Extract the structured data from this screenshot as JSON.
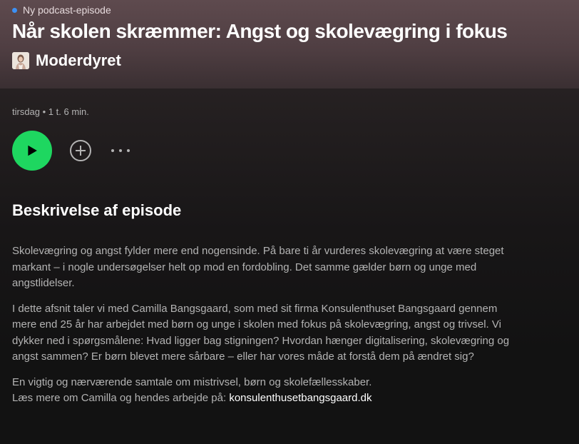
{
  "episode": {
    "badge": "Ny podcast-episode",
    "title": "Når skolen skræmmer: Angst og skolevægring i fokus",
    "show_name": "Moderdyret",
    "meta": "tirsdag • 1 t. 6 min."
  },
  "actions": {
    "play_icon": "play-icon",
    "add_icon": "add-circle-icon",
    "more_icon": "more-options-icon"
  },
  "description": {
    "heading": "Beskrivelse af episode",
    "paragraph_1": "Skolevægring og angst fylder mere end nogensinde. På bare ti år vurderes skolevægring at være steget markant – i nogle undersøgelser helt op mod en fordobling. Det samme gælder børn og unge med angstlidelser.",
    "paragraph_2": "I dette afsnit taler vi med Camilla Bangsgaard, som med sit firma Konsulenthuset Bangsgaard gennem mere end 25 år har arbejdet med børn og unge i skolen med fokus på skolevægring, angst og trivsel. Vi dykker ned i spørgsmålene: Hvad ligger bag stigningen? Hvordan hænger digitalisering, skolevægring og angst sammen? Er børn blevet mere sårbare – eller har vores måde at forstå dem på ændret sig?",
    "paragraph_3_line_1": "En vigtig og nærværende samtale om mistrivsel, børn og skolefællesskaber.",
    "paragraph_3_line_2": "Læs mere om Camilla og hendes arbejde på: ",
    "link_text": "konsulenthusetbangsgaard.dk"
  },
  "colors": {
    "accent_green": "#1ed760",
    "new_dot_blue": "#3d91f4",
    "header_bg": "#5e4a4e",
    "page_bg": "#121212"
  }
}
